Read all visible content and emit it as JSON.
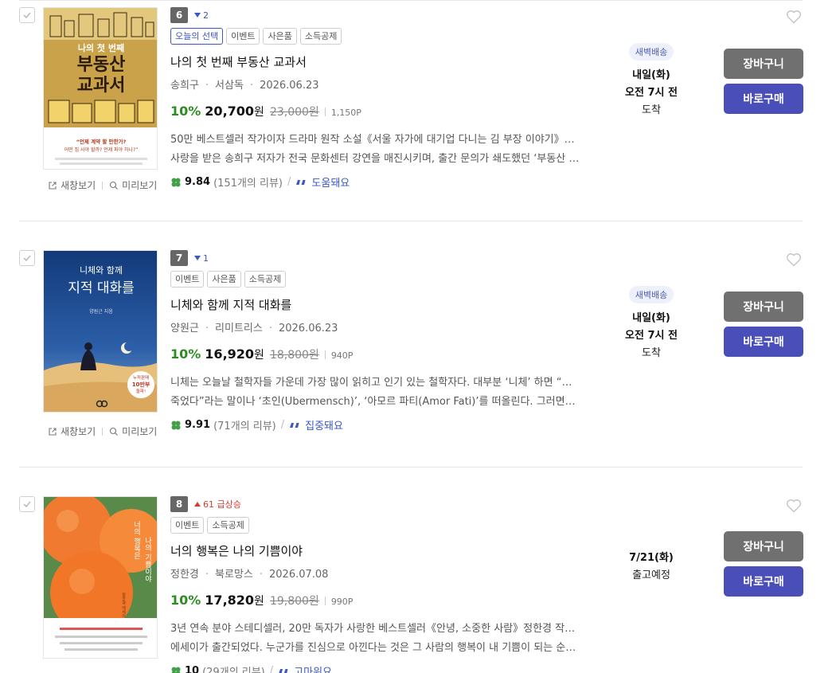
{
  "actions": {
    "new_window": "새창보기",
    "preview": "미리보기",
    "cart": "장바구니",
    "buy_now": "바로구매"
  },
  "colors": {
    "discount_green": "#2e8d22",
    "accent_blue": "#3b57c4",
    "rank_up_red": "#d43a2f",
    "cart_gray": "#707070",
    "buy_indigo": "#4a4eb8"
  },
  "items": [
    {
      "rank": "6",
      "trend": "2",
      "trend_dir": "down",
      "tags": [
        "오늘의 선택",
        "이벤트",
        "사은품",
        "소득공제"
      ],
      "title": "나의 첫 번째 부동산 교과서",
      "author": "송희구",
      "publisher": "서삼독",
      "date": "2026.06.23",
      "discount": "10%",
      "sale_price": "20,700",
      "won": "원",
      "orig_price": "23,000원",
      "points": "1,150P",
      "desc_line1": "50만 베스트셀러 작가이자 드라마 원작 소설《서울 자가에 대기업 다니는 김 부장 이야기》로 큰",
      "desc_line2": "사랑을 받은 송희구 저자가 전국 문화센터 강연을 매진시키며, 출간 문의가 쇄도했던 ‘부동산 강...",
      "score": "9.84",
      "review_count": "(151개의 리뷰)",
      "keyword": "도움돼요",
      "delivery_badge": "새벽배송",
      "delivery_line1": "내일(화)",
      "delivery_line2": "오전 7시 전",
      "delivery_line3": "도착",
      "cover": {
        "title_small": "나의 첫 번째",
        "title_big1": "부동산",
        "title_big2": "교과서",
        "tagline1": "“언제 계약 할 만한가?",
        "tagline2": "어떤 집 사야 할까? 언제 파야 하나?”"
      }
    },
    {
      "rank": "7",
      "trend": "1",
      "trend_dir": "down",
      "tags": [
        "이벤트",
        "사은품",
        "소득공제"
      ],
      "title": "니체와 함께 지적 대화를",
      "author": "양원근",
      "publisher": "리미트리스",
      "date": "2026.06.23",
      "discount": "10%",
      "sale_price": "16,920",
      "won": "원",
      "orig_price": "18,800원",
      "points": "940P",
      "desc_line1": "니체는 오늘날 철학자들 가운데 가장 많이 읽히고 인기 있는 철학자다. 대부분 ‘니체’ 하면 “신은",
      "desc_line2": "죽었다”라는 말이나 ‘초인(Ubermensch)’, ‘아모르 파티(Amor Fati)’를 떠올린다. 그러면서 자...",
      "score": "9.91",
      "review_count": "(71개의 리뷰)",
      "keyword": "집중돼요",
      "delivery_badge": "새벽배송",
      "delivery_line1": "내일(화)",
      "delivery_line2": "오전 7시 전",
      "delivery_line3": "도착",
      "cover": {
        "title_small": "니체와 함께",
        "title_big1": "지적 대화를",
        "author": "양원근 지음",
        "sticker1": "누적판매",
        "sticker2": "10만부",
        "sticker3": "돌파!"
      }
    },
    {
      "rank": "8",
      "trend": "61 급상승",
      "trend_dir": "up",
      "tags": [
        "이벤트",
        "소득공제"
      ],
      "title": "너의 행복은 나의 기쁨이야",
      "author": "정한경",
      "publisher": "북로망스",
      "date": "2026.07.08",
      "discount": "10%",
      "sale_price": "17,820",
      "won": "원",
      "orig_price": "19,800원",
      "points": "990P",
      "desc_line1": "3년 연속 분야 스테디셀러, 20만 독자가 사랑한 베스트셀러《안녕, 소중한 사람》정한경 작가의",
      "desc_line2": "에세이가 출간되었다. 누군가를 진심으로 아낀다는 것은 그 사람의 행복이 내 기쁨이 되는 순간...",
      "score": "10",
      "review_count": "(29개의 리뷰)",
      "keyword": "고마워요",
      "delivery_badge": "",
      "delivery_line1": "7/21(화)",
      "delivery_line2": "출고예정",
      "delivery_line3": "",
      "cover": {
        "title_vertical1": "너의 행복은",
        "title_vertical2": "나의 기쁨이야",
        "author": "정한경 에세이"
      }
    }
  ]
}
